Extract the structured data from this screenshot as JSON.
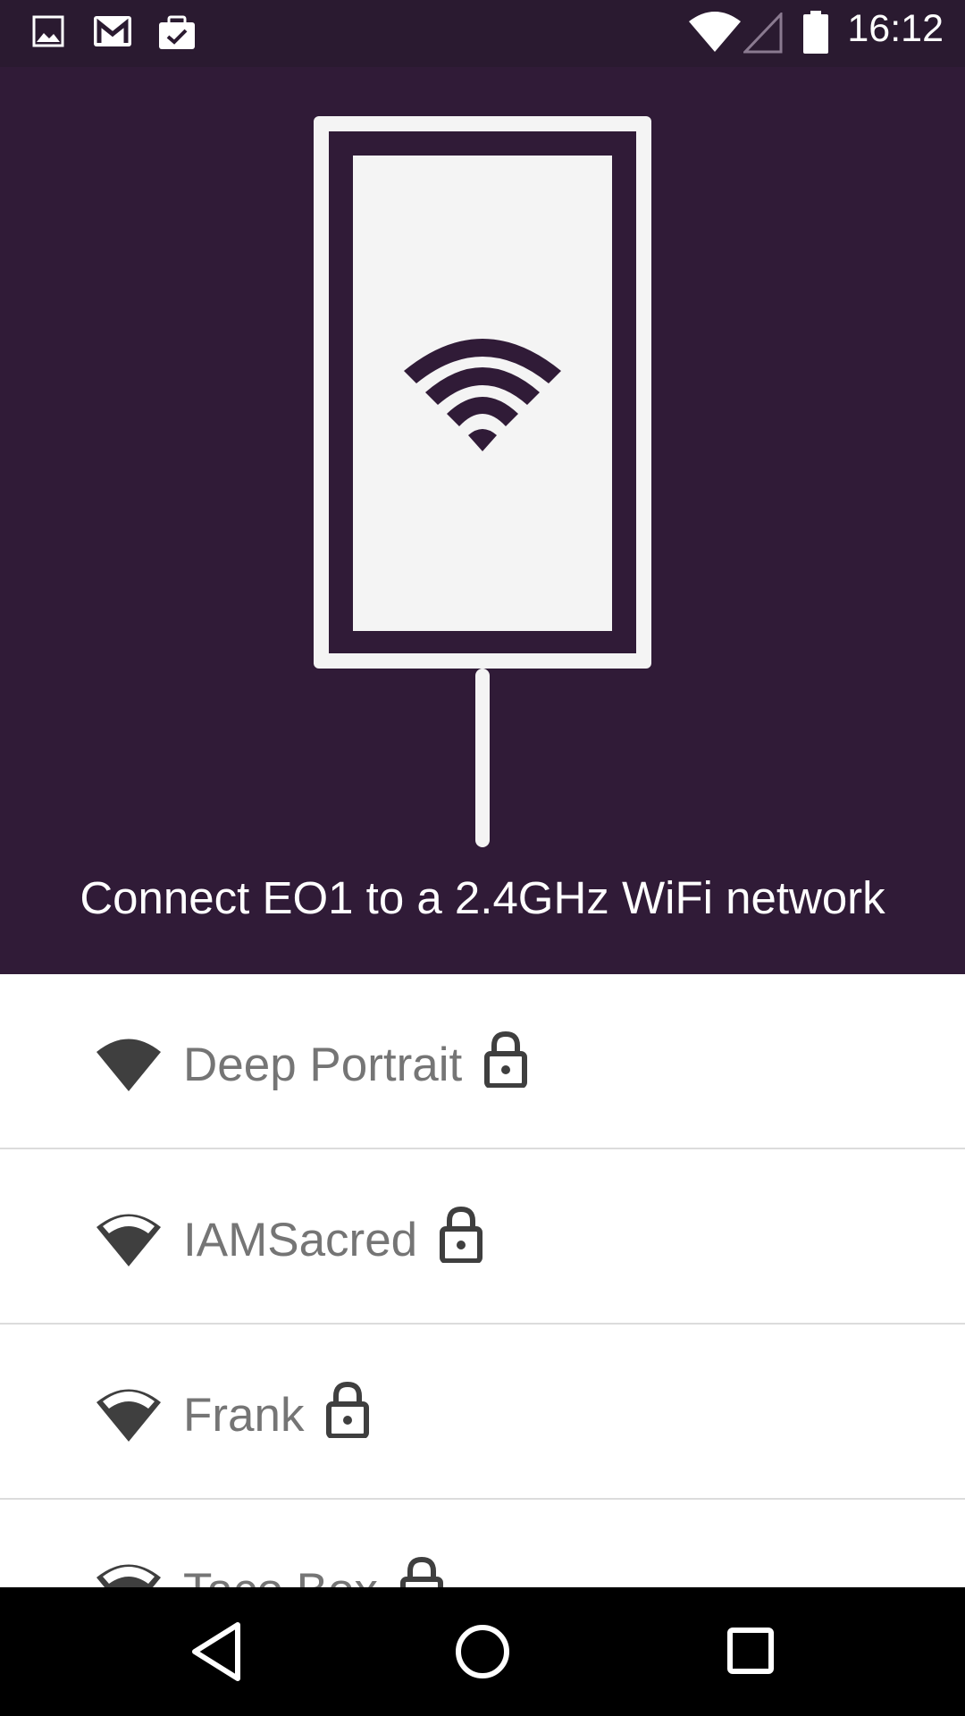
{
  "status_bar": {
    "time": "16:12",
    "left_icons": [
      "image-icon",
      "gmail-icon",
      "clipboard-check-icon"
    ],
    "right_icons": [
      "wifi-signal-icon",
      "cell-signal-empty-icon",
      "battery-icon"
    ]
  },
  "header": {
    "title": "Connect EO1 to a 2.4GHz WiFi network",
    "background_color": "#301b37",
    "illustration": "eo1-device-wifi-icon"
  },
  "networks": [
    {
      "name": "Deep Portrait",
      "signal_bars": 1,
      "secured": true
    },
    {
      "name": "IAMSacred",
      "signal_bars": 3,
      "secured": true
    },
    {
      "name": "Frank",
      "signal_bars": 3,
      "secured": true
    },
    {
      "name": "Taco Box",
      "signal_bars": 3,
      "secured": true
    }
  ],
  "nav_bar": {
    "buttons": [
      "back-icon",
      "home-icon",
      "recents-icon"
    ]
  }
}
